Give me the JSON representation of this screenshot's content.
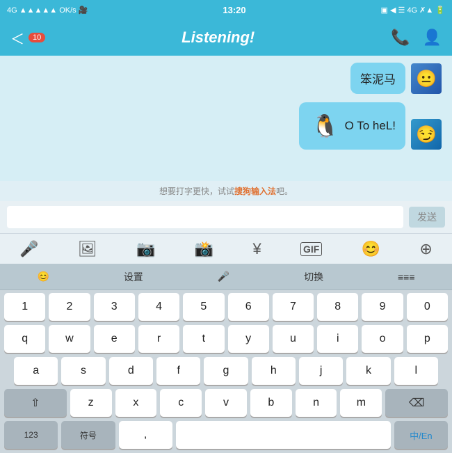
{
  "statusBar": {
    "left": "4G ▲▲▲▲▲ OK/s 🎥",
    "center": "13:20",
    "right": "▣ ◀ ☰ 4G ✗▲ 🔋"
  },
  "header": {
    "backLabel": "＜",
    "badgeCount": "10",
    "title": "Listening!",
    "callIcon": "📞",
    "profileIcon": "👤"
  },
  "messages": [
    {
      "id": 1,
      "type": "sent",
      "text": "笨泥马",
      "avatarType": "blue"
    },
    {
      "id": 2,
      "type": "sent",
      "sticker": "🐧",
      "text": "O To heL!",
      "avatarType": "char"
    }
  ],
  "hint": {
    "prefix": "想要打字更快，试试",
    "highlight": "搜狗输入法",
    "suffix": "吧。"
  },
  "input": {
    "placeholder": "",
    "sendLabel": "发送"
  },
  "toolbar": {
    "icons": [
      "🎤",
      "🖼",
      "📷",
      "📸",
      "¥",
      "GIF",
      "😊",
      "➕"
    ]
  },
  "keyboardTopBar": {
    "items": [
      "😊",
      "设置",
      "🎤",
      "切换",
      "≡≡≡"
    ]
  },
  "keyboard": {
    "rows": [
      [
        "1",
        "2",
        "3",
        "4",
        "5",
        "6",
        "7",
        "8",
        "9",
        "0"
      ],
      [
        "q",
        "w",
        "e",
        "r",
        "t",
        "y",
        "u",
        "i",
        "o",
        "p"
      ],
      [
        "a",
        "s",
        "d",
        "f",
        "g",
        "h",
        "j",
        "k",
        "l"
      ],
      [
        "⇧",
        "z",
        "x",
        "c",
        "v",
        "b",
        "n",
        "m",
        "⌫"
      ],
      [
        "123",
        "符号",
        ",",
        "",
        "",
        "",
        "中/En"
      ]
    ]
  }
}
